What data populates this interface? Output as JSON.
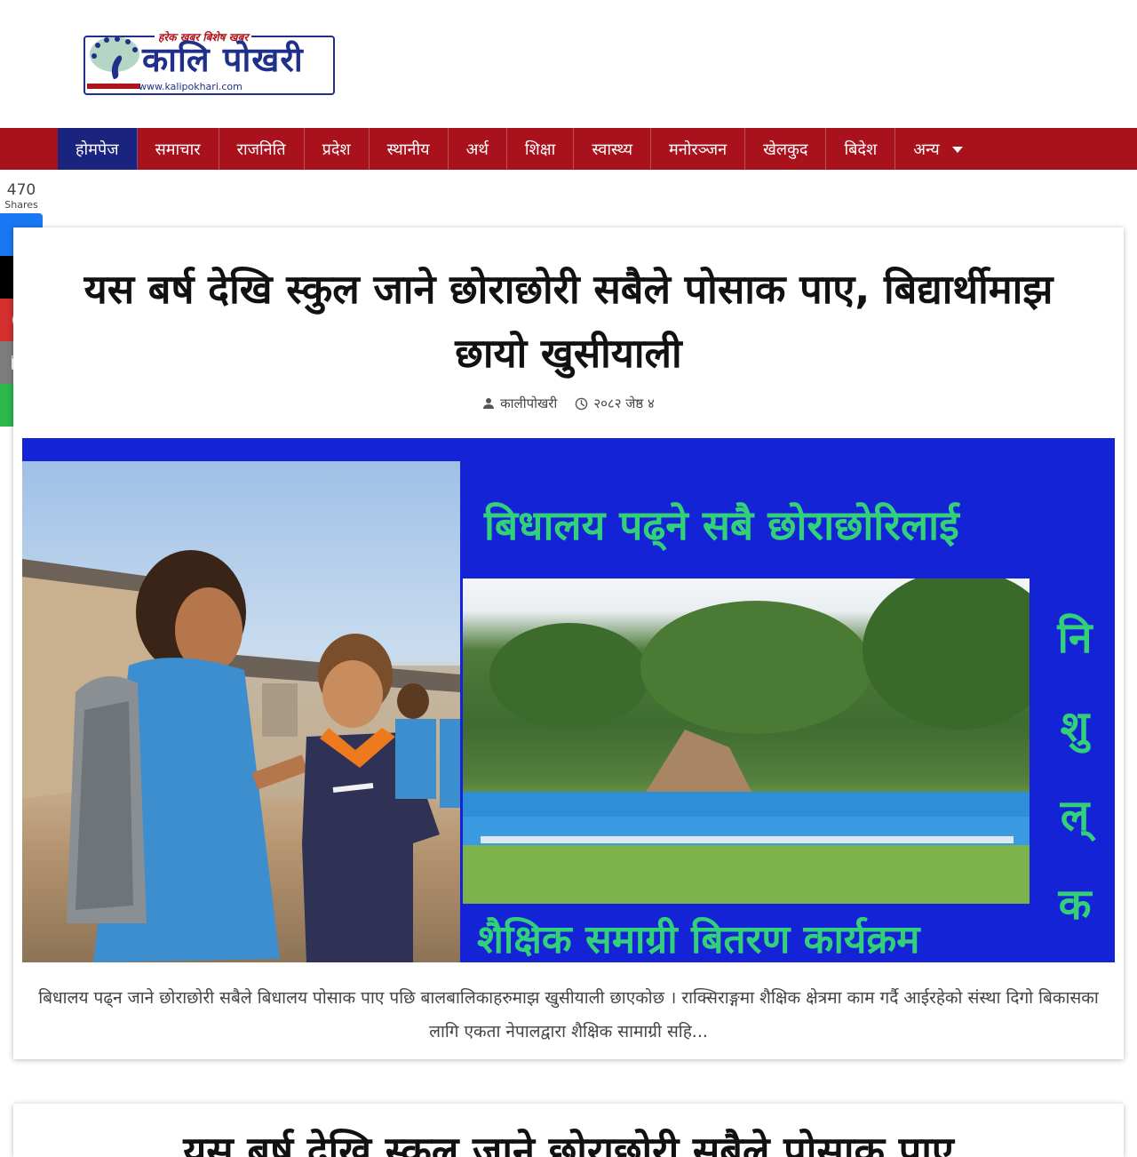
{
  "site": {
    "tagline": "हरेक खबर बिशेष खबर",
    "name": "कालि पोखरी",
    "url": "www.kalipokhari.com",
    "colors": {
      "nav_bg": "#a9121c",
      "nav_active": "#1a237e",
      "brand_blue": "#1f2f8a"
    }
  },
  "nav": {
    "items": [
      {
        "label": "होमपेज",
        "active": true
      },
      {
        "label": "समाचार"
      },
      {
        "label": "राजनिति"
      },
      {
        "label": "प्रदेश"
      },
      {
        "label": "स्थानीय"
      },
      {
        "label": "अर्थ"
      },
      {
        "label": "शिक्षा"
      },
      {
        "label": "स्वास्थ्य"
      },
      {
        "label": "मनोरञ्जन"
      },
      {
        "label": "खेलकुद"
      },
      {
        "label": "बिदेश"
      },
      {
        "label": "अन्य",
        "icon": "chevron-down-icon"
      }
    ]
  },
  "share": {
    "count": "470",
    "count_label": "Shares",
    "buttons": [
      {
        "icon": "facebook-icon",
        "color": "#1877f2"
      },
      {
        "icon": "x-icon",
        "color": "#000000"
      },
      {
        "icon": "pinterest-icon",
        "color": "#d32f2f"
      },
      {
        "icon": "email-icon",
        "color": "#7c7c7c"
      },
      {
        "icon": "share-icon",
        "color": "#2bb74a"
      }
    ]
  },
  "article": {
    "title": "यस बर्ष देखि स्कुल जाने छोराछोरी सबैले पोसाक पाए, बिद्यार्थीमाझ छायो खुसीयाली",
    "author": "कालीपोखरी",
    "date": "२०८२ जेष्ठ ४",
    "hero": {
      "headline": "बिधालय पढ्ने सबै छोराछोरिलाई",
      "vertical": [
        "नि",
        "शु",
        "ल्",
        "क"
      ],
      "footer": "शैक्षिक समाग्री बितरण कार्यक्रम"
    },
    "summary": "बिधालय पढ्न जाने छोराछोरी सबैले बिधालय पोसाक पाए पछि बालबालिकाहरुमाझ खुसीयाली छाएकोछ । राक्सिराङ्गमा शैक्षिक क्षेत्रमा काम गर्दै आईरहेको संस्था दिगो बिकासका लागि एकता नेपालद्वारा शैक्षिक सामाग्री सहि..."
  },
  "next_article": {
    "title": "यस बर्ष देखि स्कुल जाने छोराछोरी सबैले पोसाक पाए"
  }
}
